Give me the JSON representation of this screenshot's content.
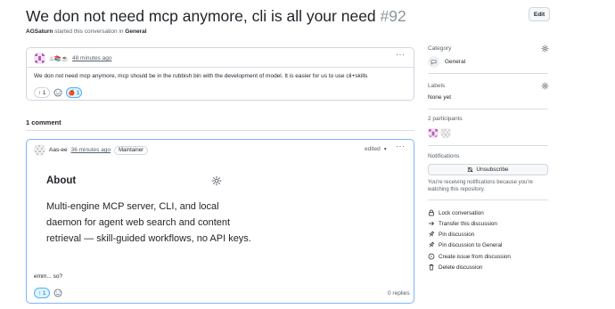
{
  "discussion": {
    "title": "We don not need mcp anymore, cli is all your need",
    "number": "#92",
    "edit_label": "Edit",
    "author": "AGSaturn",
    "started_text": "started this conversation in",
    "category": "General"
  },
  "post": {
    "author_badges": "♨📚☕",
    "time": "48 minutes ago",
    "body": "We don not need mcp anymore, mcp should be in the rubbish bin with the development of model. It is easier for us to use cli+skills",
    "upvotes": "1",
    "reaction_emoji": "🍎",
    "reaction_count": "1"
  },
  "comments_header": "1 comment",
  "comment": {
    "author": "Aas-ee",
    "time": "36 minutes ago",
    "role_badge": "Maintainer",
    "edited_label": "edited",
    "about_title": "About",
    "about_text": "Multi-engine MCP server, CLI, and local daemon for agent web search and content retrieval — skill-guided workflows, no API keys.",
    "body": "emm... so?",
    "upvotes": "1",
    "replies": "0 replies"
  },
  "sidebar": {
    "category_title": "Category",
    "category_value": "General",
    "labels_title": "Labels",
    "labels_value": "None yet",
    "participants_title": "2 participants",
    "notifications_title": "Notifications",
    "unsubscribe_label": "Unsubscribe",
    "notify_text_1": "You're receiving notifications because you're",
    "notify_text_2": "watching this repository.",
    "actions": [
      "Lock conversation",
      "Transfer this discussion",
      "Pin discussion",
      "Pin discussion to General",
      "Create issue from discussion",
      "Delete discussion"
    ]
  },
  "colors": {
    "link_blue": "#0969da",
    "border": "#d0d7de",
    "highlight_border": "#7fb3ff",
    "danger": "#1f2328"
  }
}
